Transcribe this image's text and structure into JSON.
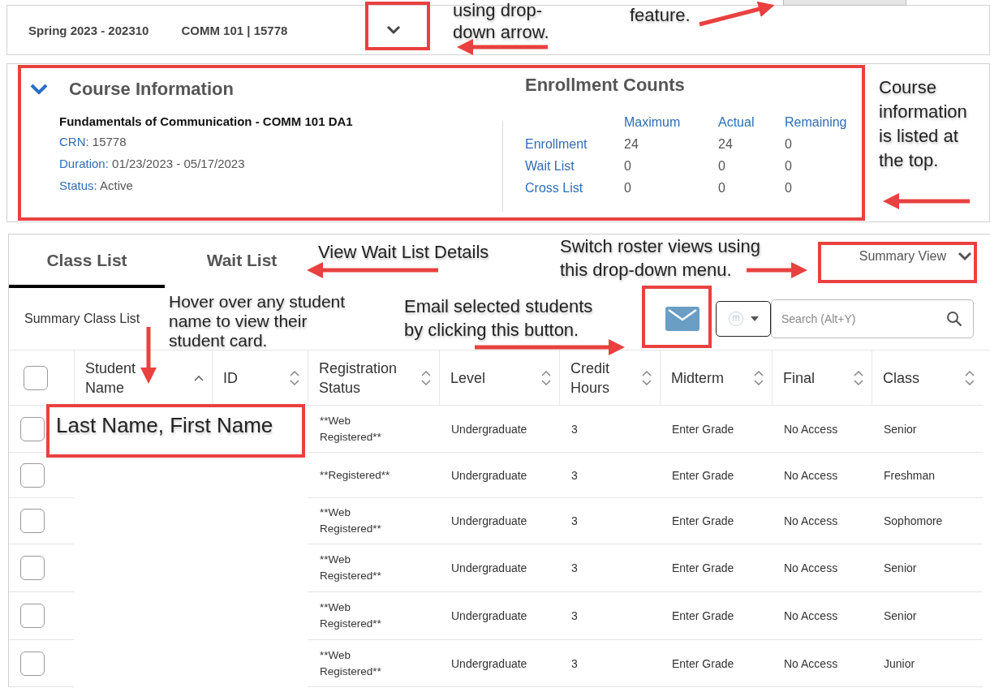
{
  "context_bar": {
    "term": "Spring 2023 - 202310",
    "course": "COMM 101 | 15778"
  },
  "course_info": {
    "title": "Course Information",
    "expanded": true,
    "course_name": "Fundamentals of Communication - COMM 101 DA1",
    "fields": [
      {
        "label": "CRN:",
        "value": "15778"
      },
      {
        "label": "Duration:",
        "value": "01/23/2023 - 05/17/2023"
      },
      {
        "label": "Status:",
        "value": "Active"
      }
    ]
  },
  "enrollment": {
    "title": "Enrollment Counts",
    "columns": [
      "Maximum",
      "Actual",
      "Remaining"
    ],
    "rows": [
      {
        "label": "Enrollment",
        "values": [
          "24",
          "24",
          "0"
        ]
      },
      {
        "label": "Wait List",
        "values": [
          "0",
          "0",
          "0"
        ]
      },
      {
        "label": "Cross List",
        "values": [
          "0",
          "0",
          "0"
        ]
      }
    ]
  },
  "tabs": [
    {
      "label": "Class List",
      "selected": true
    },
    {
      "label": "Wait List",
      "selected": false
    }
  ],
  "view_selector": "Summary View",
  "list_title": "Summary Class List",
  "search": {
    "placeholder": "Search (Alt+Y)"
  },
  "table": {
    "select_all": {
      "checked": false
    },
    "columns": [
      {
        "label": "Student\nName",
        "sorted": true
      },
      {
        "label": "ID",
        "sorted": false
      },
      {
        "label": "Registration\nStatus",
        "sorted": false
      },
      {
        "label": "Level",
        "sorted": false
      },
      {
        "label": "Credit\nHours",
        "sorted": false
      },
      {
        "label": "Midterm",
        "sorted": false
      },
      {
        "label": "Final",
        "sorted": false
      },
      {
        "label": "Class",
        "sorted": false
      }
    ],
    "rows": [
      {
        "checked": false,
        "registration_status": "**Web Registered**",
        "level": "Undergraduate",
        "credit_hours": "3",
        "midterm": "Enter Grade",
        "final": "No Access",
        "class": "Senior"
      },
      {
        "checked": false,
        "registration_status": "**Registered**",
        "level": "Undergraduate",
        "credit_hours": "3",
        "midterm": "Enter Grade",
        "final": "No Access",
        "class": "Freshman"
      },
      {
        "checked": false,
        "registration_status": "**Web Registered**",
        "level": "Undergraduate",
        "credit_hours": "3",
        "midterm": "Enter Grade",
        "final": "No Access",
        "class": "Sophomore"
      },
      {
        "checked": false,
        "registration_status": "**Web Registered**",
        "level": "Undergraduate",
        "credit_hours": "3",
        "midterm": "Enter Grade",
        "final": "No Access",
        "class": "Senior"
      },
      {
        "checked": false,
        "registration_status": "**Web Registered**",
        "level": "Undergraduate",
        "credit_hours": "3",
        "midterm": "Enter Grade",
        "final": "No Access",
        "class": "Senior"
      },
      {
        "checked": false,
        "registration_status": "**Web Registered**",
        "level": "Undergraduate",
        "credit_hours": "3",
        "midterm": "Enter Grade",
        "final": "No Access",
        "class": "Junior"
      }
    ]
  },
  "annotations": [
    {
      "text": "using drop-\ndown arrow."
    },
    {
      "text": "feature."
    },
    {
      "text": "Course\ninformation\nis listed at\nthe top."
    },
    {
      "text": "View Wait List Details"
    },
    {
      "text": "Switch roster views using\nthis drop-down menu."
    },
    {
      "text": "Hover over any student\nname to view their\nstudent card."
    },
    {
      "text": "Email selected students\nby clicking this button."
    },
    {
      "text": "Last Name, First Name"
    }
  ]
}
